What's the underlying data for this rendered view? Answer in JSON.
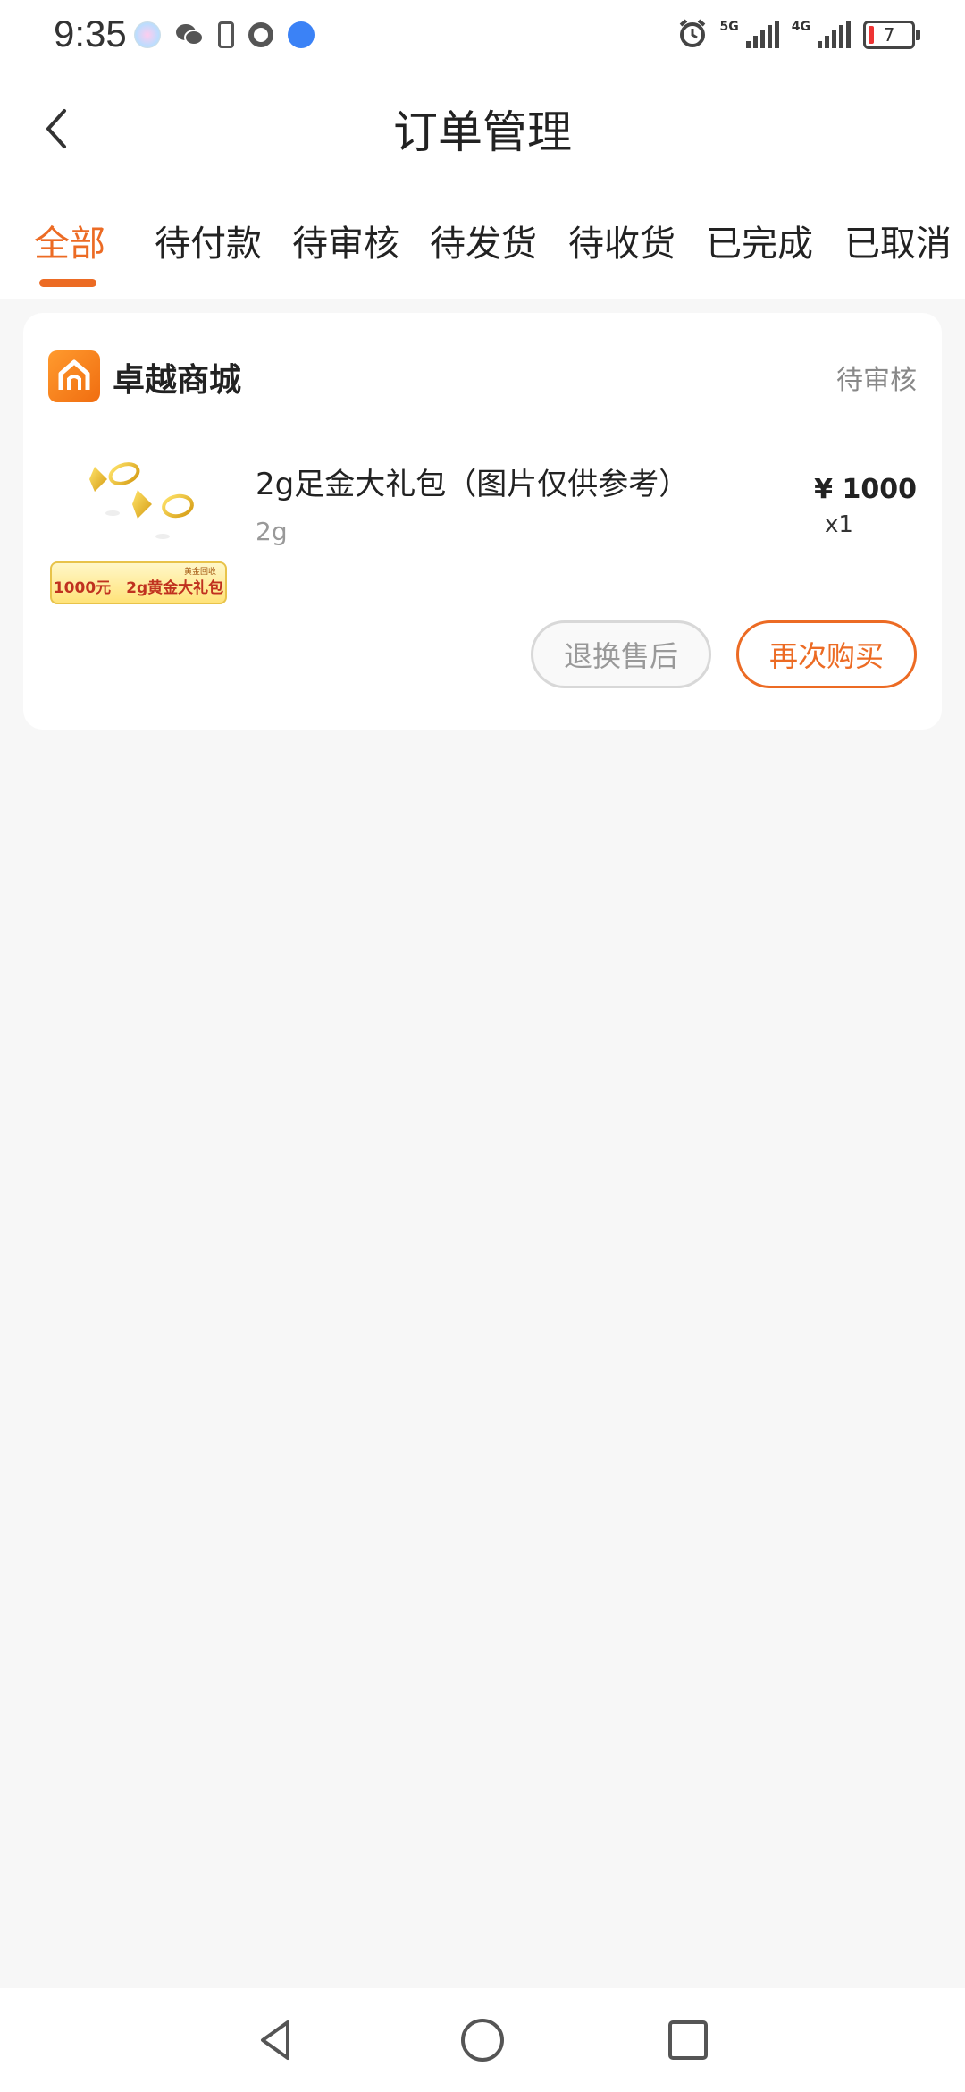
{
  "status_bar": {
    "time": "9:35",
    "network_1": "5G",
    "network_2": "4G",
    "battery": "7",
    "left_icons": [
      "app-icon",
      "wechat-icon",
      "phone-icon",
      "record-icon",
      "browser-icon"
    ],
    "right_icons": [
      "alarm-icon",
      "signal-icon",
      "signal-icon",
      "battery-icon"
    ]
  },
  "header": {
    "title": "订单管理",
    "back_icon": "chevron-left-icon"
  },
  "tabs": [
    {
      "label": "全部",
      "active": true
    },
    {
      "label": "待付款",
      "active": false
    },
    {
      "label": "待审核",
      "active": false
    },
    {
      "label": "待发货",
      "active": false
    },
    {
      "label": "待收货",
      "active": false
    },
    {
      "label": "已完成",
      "active": false
    },
    {
      "label": "已取消",
      "active": false
    }
  ],
  "order": {
    "shop_name": "卓越商城",
    "status": "待审核",
    "product": {
      "title": "2g足金大礼包（图片仅供参考）",
      "spec": "2g",
      "price": "¥ 1000",
      "quantity": "x1",
      "image_caption": "1000元　2g黄金大礼包",
      "image_tag": "黄金回收"
    },
    "buttons": {
      "return_label": "退换售后",
      "rebuy_label": "再次购买"
    }
  },
  "nav_bar": {
    "icons": [
      "back-triangle-icon",
      "home-circle-icon",
      "recents-square-icon"
    ]
  },
  "colors": {
    "accent": "#ec6b24",
    "background": "#f7f7f7",
    "card": "#ffffff"
  }
}
